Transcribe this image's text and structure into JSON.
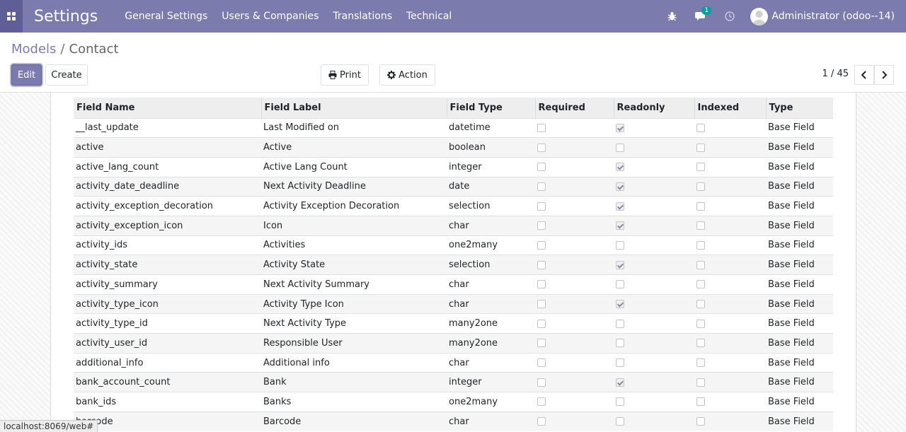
{
  "navbar": {
    "app_title": "Settings",
    "menu": [
      "General Settings",
      "Users & Companies",
      "Translations",
      "Technical"
    ],
    "messages_badge": "1",
    "user_name": "Administrator (odoo--14)"
  },
  "breadcrumb": {
    "parent": "Models",
    "separator": "/",
    "current": "Contact"
  },
  "buttons": {
    "edit": "Edit",
    "create": "Create",
    "print": "Print",
    "action": "Action"
  },
  "pager": {
    "value": "1 / 45"
  },
  "table": {
    "headers": [
      "Field Name",
      "Field Label",
      "Field Type",
      "Required",
      "Readonly",
      "Indexed",
      "Type"
    ],
    "rows": [
      {
        "name": "__last_update",
        "label": "Last Modified on",
        "type": "datetime",
        "required": false,
        "readonly": true,
        "indexed": false,
        "kind": "Base Field"
      },
      {
        "name": "active",
        "label": "Active",
        "type": "boolean",
        "required": false,
        "readonly": false,
        "indexed": false,
        "kind": "Base Field"
      },
      {
        "name": "active_lang_count",
        "label": "Active Lang Count",
        "type": "integer",
        "required": false,
        "readonly": true,
        "indexed": false,
        "kind": "Base Field"
      },
      {
        "name": "activity_date_deadline",
        "label": "Next Activity Deadline",
        "type": "date",
        "required": false,
        "readonly": true,
        "indexed": false,
        "kind": "Base Field"
      },
      {
        "name": "activity_exception_decoration",
        "label": "Activity Exception Decoration",
        "type": "selection",
        "required": false,
        "readonly": true,
        "indexed": false,
        "kind": "Base Field"
      },
      {
        "name": "activity_exception_icon",
        "label": "Icon",
        "type": "char",
        "required": false,
        "readonly": true,
        "indexed": false,
        "kind": "Base Field"
      },
      {
        "name": "activity_ids",
        "label": "Activities",
        "type": "one2many",
        "required": false,
        "readonly": false,
        "indexed": false,
        "kind": "Base Field"
      },
      {
        "name": "activity_state",
        "label": "Activity State",
        "type": "selection",
        "required": false,
        "readonly": true,
        "indexed": false,
        "kind": "Base Field"
      },
      {
        "name": "activity_summary",
        "label": "Next Activity Summary",
        "type": "char",
        "required": false,
        "readonly": false,
        "indexed": false,
        "kind": "Base Field"
      },
      {
        "name": "activity_type_icon",
        "label": "Activity Type Icon",
        "type": "char",
        "required": false,
        "readonly": true,
        "indexed": false,
        "kind": "Base Field"
      },
      {
        "name": "activity_type_id",
        "label": "Next Activity Type",
        "type": "many2one",
        "required": false,
        "readonly": false,
        "indexed": false,
        "kind": "Base Field"
      },
      {
        "name": "activity_user_id",
        "label": "Responsible User",
        "type": "many2one",
        "required": false,
        "readonly": false,
        "indexed": false,
        "kind": "Base Field"
      },
      {
        "name": "additional_info",
        "label": "Additional info",
        "type": "char",
        "required": false,
        "readonly": false,
        "indexed": false,
        "kind": "Base Field"
      },
      {
        "name": "bank_account_count",
        "label": "Bank",
        "type": "integer",
        "required": false,
        "readonly": true,
        "indexed": false,
        "kind": "Base Field"
      },
      {
        "name": "bank_ids",
        "label": "Banks",
        "type": "one2many",
        "required": false,
        "readonly": false,
        "indexed": false,
        "kind": "Base Field"
      },
      {
        "name": "barcode",
        "label": "Barcode",
        "type": "char",
        "required": false,
        "readonly": false,
        "indexed": false,
        "kind": "Base Field"
      }
    ]
  },
  "statusbar": {
    "url": "localhost:8069/web#"
  },
  "colors": {
    "brand": "#7c7bad",
    "brand_dark": "#5f5e97"
  },
  "icons": [
    "apps-icon",
    "bug-icon",
    "chat-icon",
    "clock-icon",
    "print-icon",
    "gear-icon",
    "chevron-left-icon",
    "chevron-right-icon"
  ]
}
